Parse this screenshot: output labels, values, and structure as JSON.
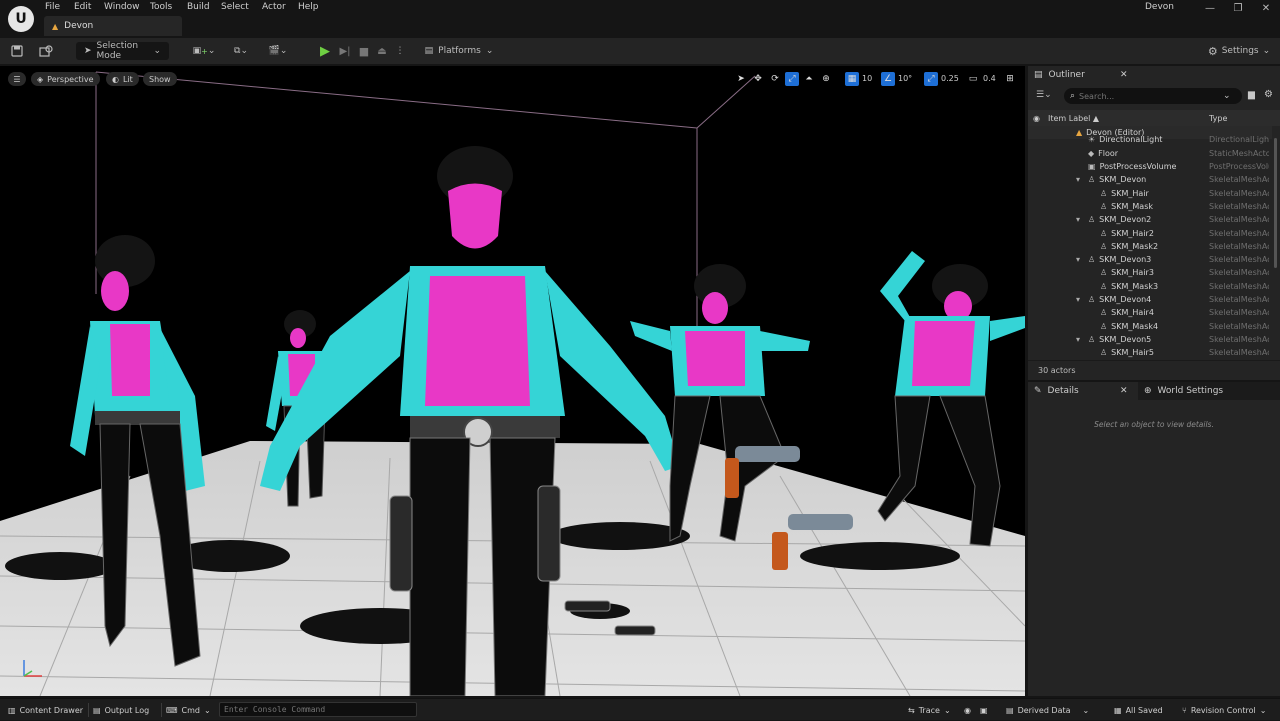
{
  "menubar": {
    "items": [
      "File",
      "Edit",
      "Window",
      "Tools",
      "Build",
      "Select",
      "Actor",
      "Help"
    ],
    "project_name": "Devon"
  },
  "level_tab": {
    "label": "Devon"
  },
  "toolbar": {
    "mode_label": "Selection Mode",
    "platforms_label": "Platforms",
    "settings_label": "Settings"
  },
  "viewport": {
    "perspective_label": "Perspective",
    "lit_label": "Lit",
    "show_label": "Show",
    "grid_snap": "10",
    "rotation_snap": "10°",
    "scale_snap": "0.25",
    "camera_speed": "0.4",
    "colors": {
      "cyan": "#35d4d6",
      "magenta": "#e838c6",
      "floor": "#dcdcdc"
    }
  },
  "outliner": {
    "title": "Outliner",
    "search_placeholder": "Search...",
    "col_label": "Item Label ▲",
    "col_type": "Type",
    "rows": [
      {
        "label": "Devon (Editor)",
        "type": "",
        "indent": 0,
        "icon": "level-icon",
        "expander": ""
      },
      {
        "label": "DirectionalLight",
        "type": "DirectionalLight",
        "indent": 1,
        "icon": "light-icon",
        "expander": ""
      },
      {
        "label": "Floor",
        "type": "StaticMeshActor",
        "indent": 1,
        "icon": "mesh-icon",
        "expander": ""
      },
      {
        "label": "PostProcessVolume",
        "type": "PostProcessVolume",
        "indent": 1,
        "icon": "volume-icon",
        "expander": ""
      },
      {
        "label": "SKM_Devon",
        "type": "SkeletalMeshActor",
        "indent": 1,
        "icon": "skeleton-icon",
        "expander": "▾"
      },
      {
        "label": "SKM_Hair",
        "type": "SkeletalMeshActor",
        "indent": 2,
        "icon": "skeleton-icon",
        "expander": ""
      },
      {
        "label": "SKM_Mask",
        "type": "SkeletalMeshActor",
        "indent": 2,
        "icon": "skeleton-icon",
        "expander": ""
      },
      {
        "label": "SKM_Devon2",
        "type": "SkeletalMeshActor",
        "indent": 1,
        "icon": "skeleton-icon",
        "expander": "▾"
      },
      {
        "label": "SKM_Hair2",
        "type": "SkeletalMeshActor",
        "indent": 2,
        "icon": "skeleton-icon",
        "expander": ""
      },
      {
        "label": "SKM_Mask2",
        "type": "SkeletalMeshActor",
        "indent": 2,
        "icon": "skeleton-icon",
        "expander": ""
      },
      {
        "label": "SKM_Devon3",
        "type": "SkeletalMeshActor",
        "indent": 1,
        "icon": "skeleton-icon",
        "expander": "▾"
      },
      {
        "label": "SKM_Hair3",
        "type": "SkeletalMeshActor",
        "indent": 2,
        "icon": "skeleton-icon",
        "expander": ""
      },
      {
        "label": "SKM_Mask3",
        "type": "SkeletalMeshActor",
        "indent": 2,
        "icon": "skeleton-icon",
        "expander": ""
      },
      {
        "label": "SKM_Devon4",
        "type": "SkeletalMeshActor",
        "indent": 1,
        "icon": "skeleton-icon",
        "expander": "▾"
      },
      {
        "label": "SKM_Hair4",
        "type": "SkeletalMeshActor",
        "indent": 2,
        "icon": "skeleton-icon",
        "expander": ""
      },
      {
        "label": "SKM_Mask4",
        "type": "SkeletalMeshActor",
        "indent": 2,
        "icon": "skeleton-icon",
        "expander": ""
      },
      {
        "label": "SKM_Devon5",
        "type": "SkeletalMeshActor",
        "indent": 1,
        "icon": "skeleton-icon",
        "expander": "▾"
      },
      {
        "label": "SKM_Hair5",
        "type": "SkeletalMeshActor",
        "indent": 2,
        "icon": "skeleton-icon",
        "expander": ""
      }
    ],
    "actor_count": "30 actors"
  },
  "details": {
    "tab_details": "Details",
    "tab_world": "World Settings",
    "empty_message": "Select an object to view details."
  },
  "statusbar": {
    "content_drawer": "Content Drawer",
    "output_log": "Output Log",
    "cmd_label": "Cmd",
    "cmd_placeholder": "Enter Console Command",
    "trace_label": "Trace",
    "derived_data": "Derived Data",
    "all_saved": "All Saved",
    "revision_control": "Revision Control"
  }
}
